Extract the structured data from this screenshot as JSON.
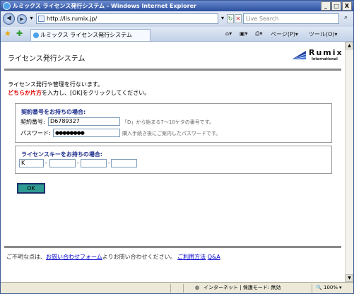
{
  "window": {
    "title": "ルミックス ライセンス発行システム - Windows Internet Explorer",
    "controls": {
      "minimize": "_",
      "maximize": "□",
      "close": "X"
    }
  },
  "address_bar": {
    "url": "http://lis.rumix.jp/",
    "search_placeholder": "Live Search",
    "buttons": {
      "refresh": "↻",
      "stop": "✕",
      "go": "▾"
    }
  },
  "tabs": [
    {
      "label": "ルミックス ライセンス発行システム"
    }
  ],
  "toolbar": {
    "page_label": "ページ(P)",
    "tools_label": "ツール(O)"
  },
  "page": {
    "site_title": "ライセンス発行システム",
    "logo": {
      "word": "Rumix",
      "sub": "International"
    },
    "intro_line1": "ライセンス発行や管理を行ないます。",
    "intro_line2_red": "どちらか片方",
    "intro_line2_rest": "を入力し、[OK]をクリックしてください。",
    "contract_section": {
      "title": "契約番号をお持ちの場合:",
      "contract_label": "契約番号:",
      "contract_value": "D6789327",
      "contract_hint": "「D」から始まる7〜10ケタの番号です。",
      "password_label": "パスワード:",
      "password_value": "●●●●●●●●",
      "password_hint": "購入手続き後にご案内したパスワードです。"
    },
    "license_section": {
      "title": "ライセンスキーをお持ちの場合:",
      "key_parts": [
        "K",
        "",
        "",
        ""
      ],
      "separator": "-"
    },
    "ok_button": "OK",
    "footer": {
      "prefix": "ご不明な点は、",
      "contact_link": "お問い合わせフォーム",
      "middle": "よりお問い合わせください。",
      "usage_link": "ご利用方法",
      "qa_link": "Q&A"
    }
  },
  "statusbar": {
    "zone": "インターネット | 保護モード: 無効",
    "zoom": "100%"
  }
}
